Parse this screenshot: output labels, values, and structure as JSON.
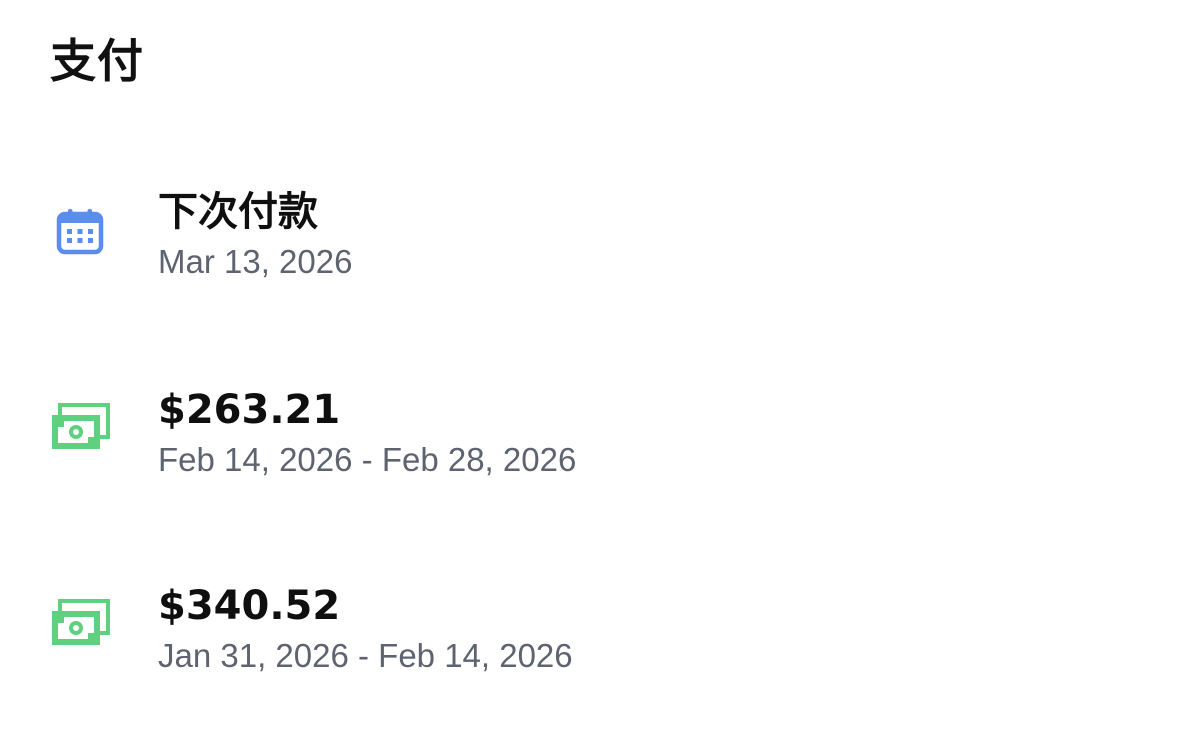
{
  "header": {
    "title": "支付"
  },
  "colors": {
    "calendar_icon": "#5b8def",
    "cash_icon": "#5fd07f",
    "title_text": "#111111",
    "subtitle_text": "#5e6370"
  },
  "next_payment": {
    "icon": "calendar-icon",
    "label": "下次付款",
    "date": "Mar 13, 2026"
  },
  "payments": [
    {
      "icon": "cash-icon",
      "amount": "$263.21",
      "period": "Feb 14, 2026 - Feb 28, 2026"
    },
    {
      "icon": "cash-icon",
      "amount": "$340.52",
      "period": "Jan 31, 2026 - Feb 14, 2026"
    }
  ]
}
